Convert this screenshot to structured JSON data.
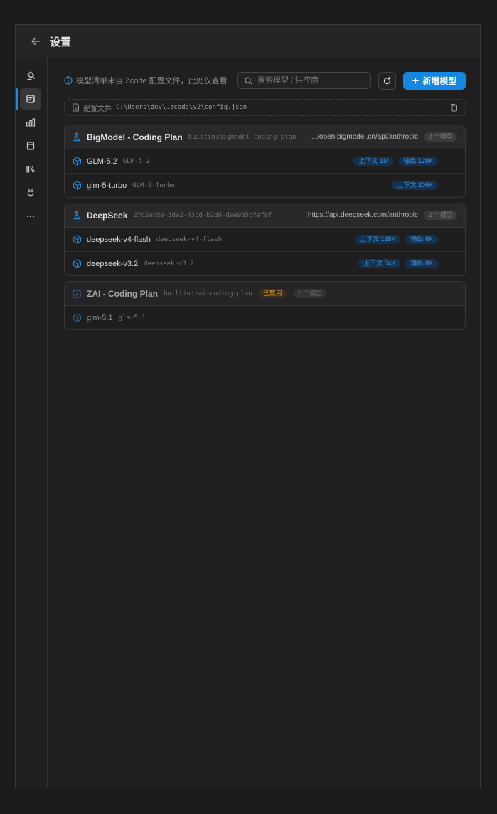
{
  "titlebar": {
    "title": "设置"
  },
  "sidebar": {
    "items": [
      {
        "icon": "paint-bucket-icon",
        "active": false
      },
      {
        "icon": "model-list-icon",
        "active": true
      },
      {
        "icon": "bar-chart-icon",
        "active": false
      },
      {
        "icon": "database-icon",
        "active": false
      },
      {
        "icon": "library-icon",
        "active": false
      },
      {
        "icon": "plug-icon",
        "active": false
      },
      {
        "icon": "more-icon",
        "active": false
      }
    ]
  },
  "toolbar": {
    "notice": "模型清单来自 Zcode 配置文件，此处仅查看",
    "search_placeholder": "搜索模型 / 供应商",
    "add_label": "新增模型"
  },
  "config": {
    "label": "配置文件",
    "path": "C:\\Users\\dev\\.zcode\\v2\\config.json"
  },
  "providers": [
    {
      "name": "BigModel - Coding Plan",
      "id": "builtin:bigmodel-coding-plan",
      "url": ".../open.bigmodel.cn/api/anthropic",
      "count": "2 个模型",
      "models": [
        {
          "name": "GLM-5.2",
          "id": "GLM-5.2",
          "context": "上下文 1M",
          "output": "输出 128K"
        },
        {
          "name": "glm-5-turbo",
          "id": "GLM-5-Turbo",
          "context": "上下文 205K",
          "output": ""
        }
      ]
    },
    {
      "name": "DeepSeek",
      "id": "27d2ecde-5da2-43bd-b2d8-dae985bfaf8f",
      "url": "https://api.deepseek.com/anthropic",
      "count": "2 个模型",
      "models": [
        {
          "name": "deepseek-v4-flash",
          "id": "deepseek-v4-flash",
          "context": "上下文 128K",
          "output": "输出 8K"
        },
        {
          "name": "deepseek-v3.2",
          "id": "deepseek-v3.2",
          "context": "上下文 64K",
          "output": "输出 8K"
        }
      ]
    },
    {
      "name": "ZAI - Coding Plan",
      "id": "builtin:zai-coding-plan",
      "status": "已禁用",
      "count": "1 个模型",
      "models": [
        {
          "name": "glm-5.1",
          "id": "glm-5.1"
        }
      ]
    }
  ],
  "colors": {
    "accent": "#1487e0",
    "tag_bg": "#14324f",
    "tag_text": "#3b95e0",
    "disabled": "#d79a35"
  }
}
